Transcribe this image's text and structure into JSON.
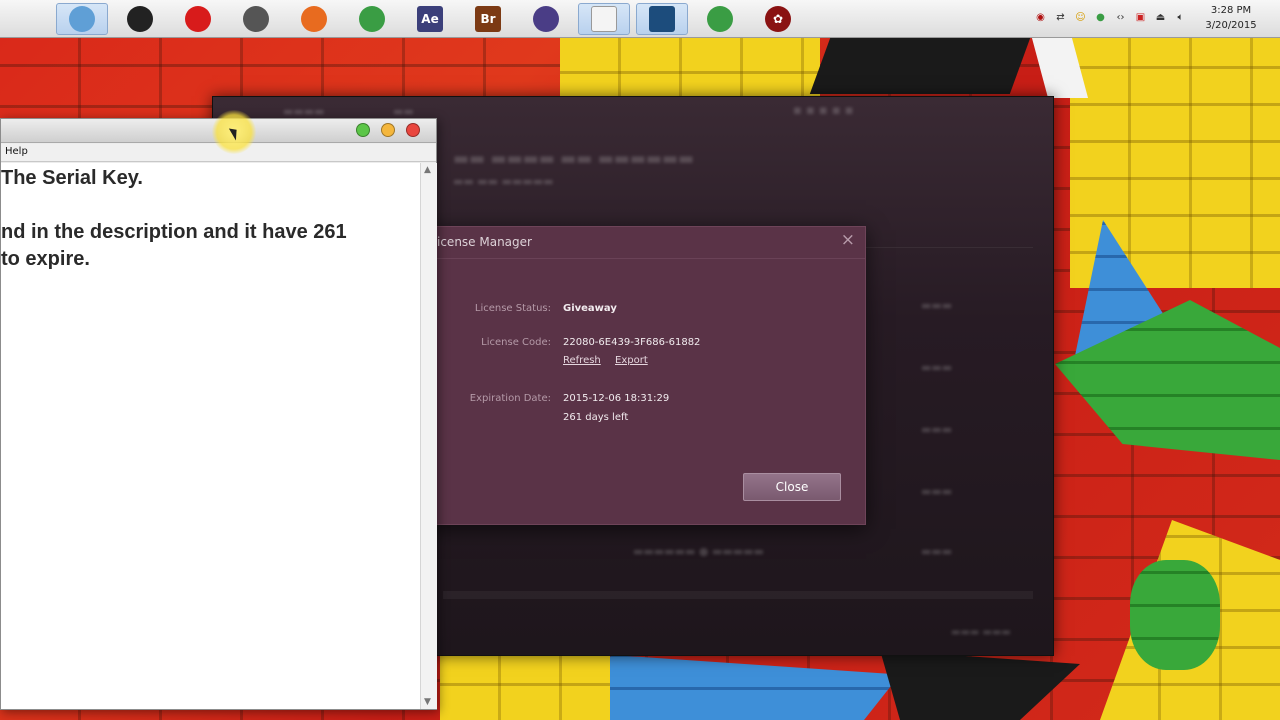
{
  "taskbar": {
    "icons": [
      {
        "name": "apple-icon",
        "glyph": "",
        "color": "#444444"
      },
      {
        "name": "finder-icon",
        "glyph": "",
        "color": "#5f9fd6"
      },
      {
        "name": "camera-app-icon",
        "glyph": "",
        "color": "#222222"
      },
      {
        "name": "record-app-icon",
        "glyph": "",
        "color": "#d81b1b"
      },
      {
        "name": "media-app-icon",
        "glyph": "",
        "color": "#555555"
      },
      {
        "name": "firefox-icon",
        "glyph": "",
        "color": "#e86b1f"
      },
      {
        "name": "chrome-icon",
        "glyph": "",
        "color": "#3a9d44"
      },
      {
        "name": "after-effects-icon",
        "glyph": "Ae",
        "color": "#3b3f7a"
      },
      {
        "name": "bridge-icon",
        "glyph": "Br",
        "color": "#7c3a14"
      },
      {
        "name": "video-editor-icon",
        "glyph": "",
        "color": "#4a3d86"
      },
      {
        "name": "notes-app-icon",
        "glyph": "",
        "color": "#f4f4f4"
      },
      {
        "name": "film-app-icon",
        "glyph": "",
        "color": "#1c4c7c"
      },
      {
        "name": "chrome-canary-icon",
        "glyph": "",
        "color": "#3a9d44"
      },
      {
        "name": "settings-app-icon",
        "glyph": "✿",
        "color": "#8a1212"
      }
    ],
    "clock_time": "3:28 PM",
    "clock_date": "3/20/2015"
  },
  "editor": {
    "menu_help": "Help",
    "lines": [
      " The Serial Key.",
      "",
      "nd in the description and it have 261",
      " to expire."
    ]
  },
  "license_dialog": {
    "title": "icense Manager",
    "status_label": "License Status:",
    "status_value": "Giveaway",
    "code_label": "License Code:",
    "code_value": "22080-6E439-3F686-61882",
    "refresh_link": "Refresh",
    "export_link": "Export",
    "expiration_label": "Expiration Date:",
    "expiration_value": "2015-12-06 18:31:29",
    "days_left": "261 days left",
    "close_button": "Close",
    "close_icon": "×"
  },
  "colors": {
    "dialog_bg": "#5a3347",
    "dark_app_bg": "#271b24",
    "button_bg": "#8a6a80"
  }
}
